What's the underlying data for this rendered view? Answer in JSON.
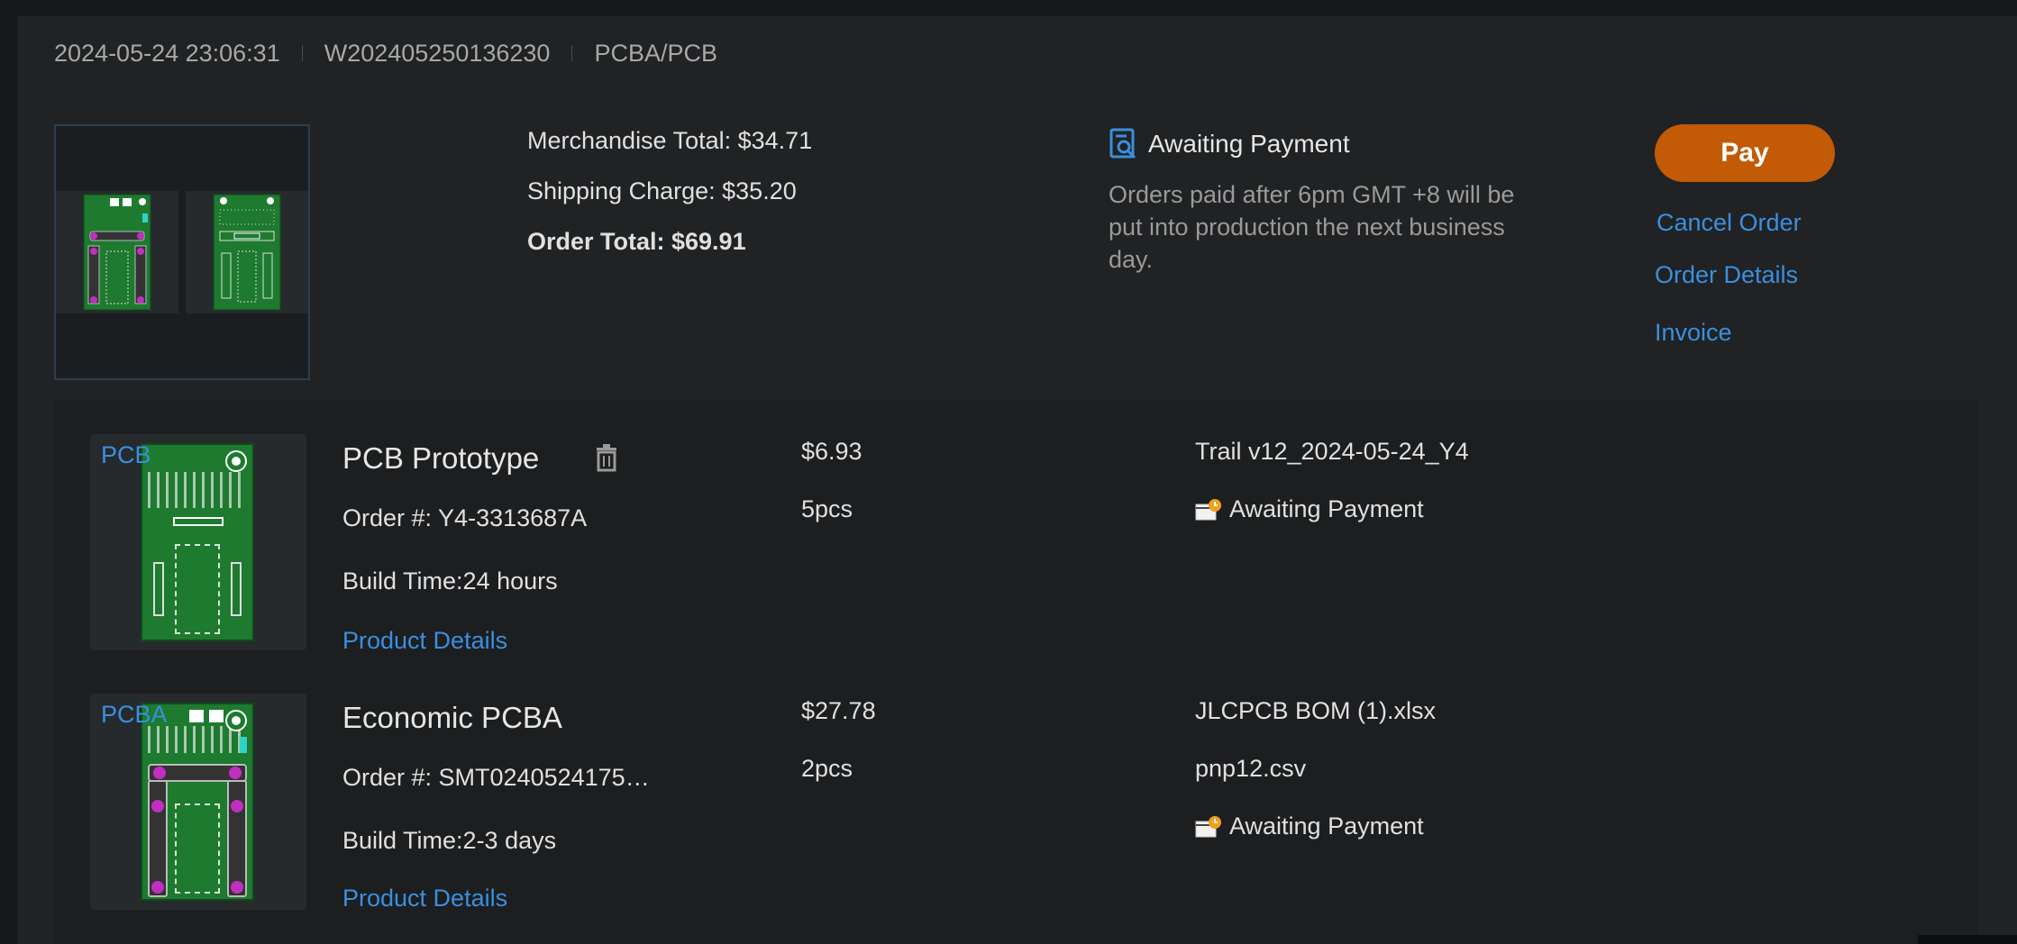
{
  "order": {
    "datetime": "2024-05-24 23:06:31",
    "order_no": "W202405250136230",
    "category": "PCBA/PCB"
  },
  "totals": {
    "merchandise": "Merchandise Total: $34.71",
    "shipping": "Shipping Charge: $35.20",
    "order_total": "Order Total: $69.91"
  },
  "status": {
    "title": "Awaiting Payment",
    "note": "Orders paid after 6pm GMT +8 will be put into production the next business day."
  },
  "actions": {
    "pay": "Pay",
    "cancel": "Cancel Order",
    "details": "Order Details",
    "invoice": "Invoice"
  },
  "items": [
    {
      "tag": "PCB",
      "name": "PCB Prototype",
      "order": "Order #: Y4-3313687A",
      "build": "Build Time:24 hours",
      "details": "Product Details",
      "price": "$6.93",
      "qty": "5pcs",
      "file": "Trail v12_2024-05-24_Y4",
      "status": "Awaiting Payment"
    },
    {
      "tag": "PCBA",
      "name": "Economic PCBA",
      "order": "Order #: SMT0240524175…",
      "build": "Build Time:2-3 days",
      "details": "Product Details",
      "price": "$27.78",
      "qty": "2pcs",
      "file": "JLCPCB BOM (1).xlsx",
      "file2": "pnp12.csv",
      "status": "Awaiting Payment"
    }
  ],
  "colors": {
    "accent": "#3b8fde",
    "pay_button": "#c25a06",
    "background": "#202224"
  },
  "icons": {
    "status": "order-search-icon",
    "delete": "trash-icon",
    "item_status": "pending-envelope-icon"
  }
}
